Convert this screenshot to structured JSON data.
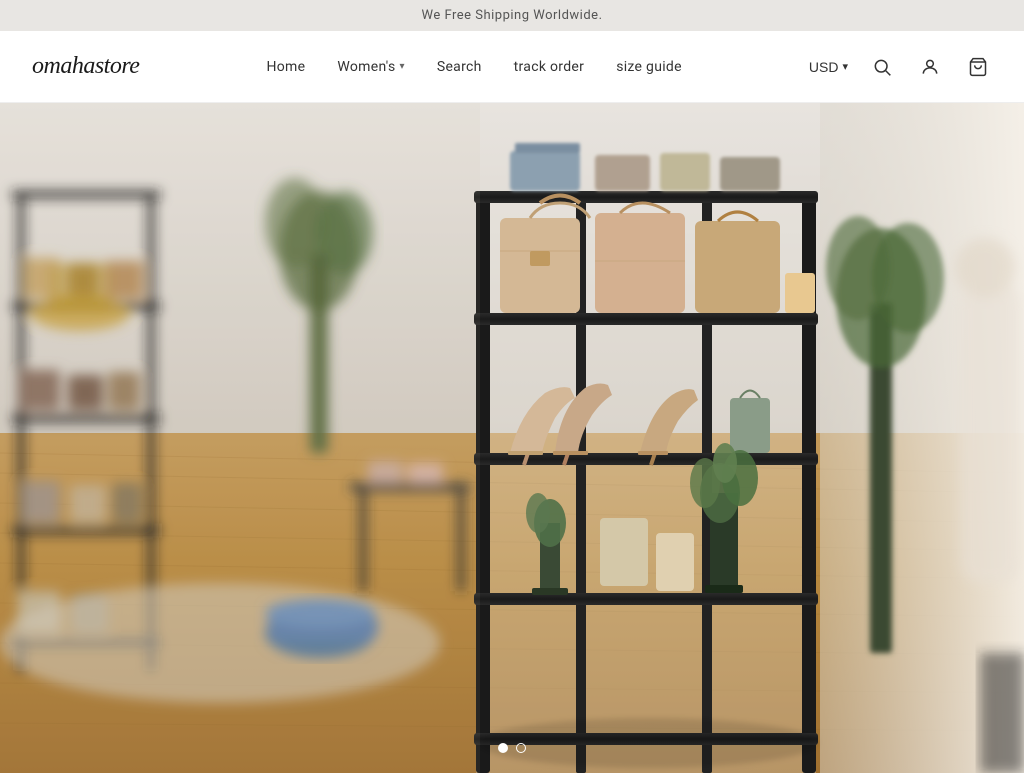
{
  "announcement": {
    "text": "We Free Shipping Worldwide."
  },
  "header": {
    "logo": "omahastore",
    "nav": [
      {
        "label": "Home",
        "hasDropdown": false
      },
      {
        "label": "Women's",
        "hasDropdown": true
      },
      {
        "label": "Search",
        "hasDropdown": false
      },
      {
        "label": "track order",
        "hasDropdown": false
      },
      {
        "label": "size guide",
        "hasDropdown": false
      }
    ],
    "currency": "USD",
    "icons": [
      "search",
      "account",
      "cart"
    ]
  },
  "hero": {
    "slideCount": 2,
    "activeSlide": 0
  },
  "carousel": {
    "dot1_label": "Slide 1",
    "dot2_label": "Slide 2"
  }
}
